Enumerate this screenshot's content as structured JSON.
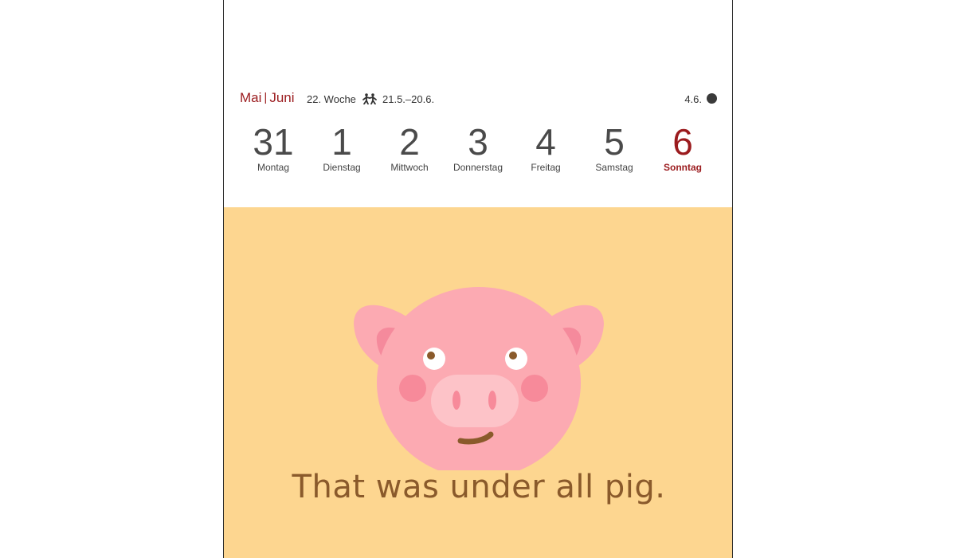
{
  "header": {
    "month_1": "Mai",
    "separator": "|",
    "month_2": "Juni",
    "week": "22. Woche",
    "zodiac_icon": "gemini-twins-icon",
    "zodiac_range": "21.5.–20.6.",
    "moon_date": "4.6.",
    "moon_icon": "full-moon-icon"
  },
  "days": [
    {
      "num": "31",
      "name": "Montag"
    },
    {
      "num": "1",
      "name": "Dienstag"
    },
    {
      "num": "2",
      "name": "Mittwoch"
    },
    {
      "num": "3",
      "name": "Donnerstag"
    },
    {
      "num": "4",
      "name": "Freitag"
    },
    {
      "num": "5",
      "name": "Samstag"
    },
    {
      "num": "6",
      "name": "Sonntag"
    }
  ],
  "illustration": {
    "icon": "pig-face-icon",
    "caption": "That was under all pig."
  },
  "colors": {
    "accent_red": "#9b1b1e",
    "background_yellow": "#fdd690",
    "pig_pink": "#fcaab2",
    "caption_brown": "#8a5a2b"
  }
}
